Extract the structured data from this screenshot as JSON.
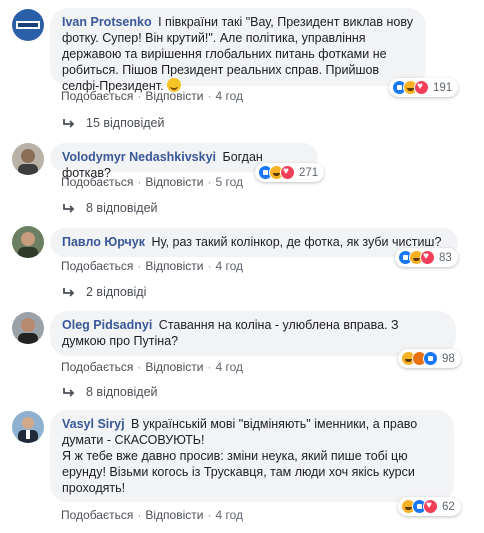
{
  "comments": [
    {
      "author": "Ivan Protsenko",
      "text": "І півкраїни такі \"Вау, Президент виклав нову фотку. Супер! Він крутий!\". Але політика, управління державою та вирішення глобальних питань фотками не робиться. Пішов Президент реальних справ. Прийшов селфі-Президент.",
      "emoji": "slightly-smiling-face",
      "like_label": "Подобається",
      "reply_label": "Відповісти",
      "time": "4 год",
      "reaction_count": "191",
      "reactions": [
        "like-icon",
        "haha-icon",
        "love-icon"
      ],
      "replies_label": "15 відповідей"
    },
    {
      "author": "Volodymyr Nedashkivskyi",
      "text": "Богдан фоткав?",
      "like_label": "Подобається",
      "reply_label": "Відповісти",
      "time": "5 год",
      "reaction_count": "271",
      "reactions": [
        "like-icon",
        "haha-icon",
        "love-icon"
      ],
      "replies_label": "8 відповідей"
    },
    {
      "author": "Павло Юрчук",
      "text": "Ну, раз такий колінкор, де фотка, як зуби чистиш?",
      "like_label": "Подобається",
      "reply_label": "Відповісти",
      "time": "4 год",
      "reaction_count": "83",
      "reactions": [
        "like-icon",
        "haha-icon",
        "love-icon"
      ],
      "replies_label": "2 відповіді"
    },
    {
      "author": "Oleg Pidsadnyi",
      "text": "Ставання на коліна - улюблена вправа. З думкою про Путіна?",
      "like_label": "Подобається",
      "reply_label": "Відповісти",
      "time": "4 год",
      "reaction_count": "98",
      "reactions": [
        "haha-icon",
        "angry-icon",
        "like-icon"
      ],
      "replies_label": "8 відповідей"
    },
    {
      "author": "Vasyl Siryj",
      "text_lines": [
        "В українській мові \"відміняють\" іменники, а право думати - СКАСОВУЮТЬ!",
        "Я ж тебе вже давно просив: зміни неука, який пише тобі цю ерунду! Візьми когось із Трускавця, там люди хоч якісь курси проходять!"
      ],
      "like_label": "Подобається",
      "reply_label": "Відповісти",
      "time": "4 год",
      "reaction_count": "62",
      "reactions": [
        "haha-icon",
        "like-icon",
        "love-icon"
      ]
    }
  ],
  "colors": {
    "author": "#385898",
    "bubble": "#f2f3f5",
    "meta": "#606770"
  }
}
